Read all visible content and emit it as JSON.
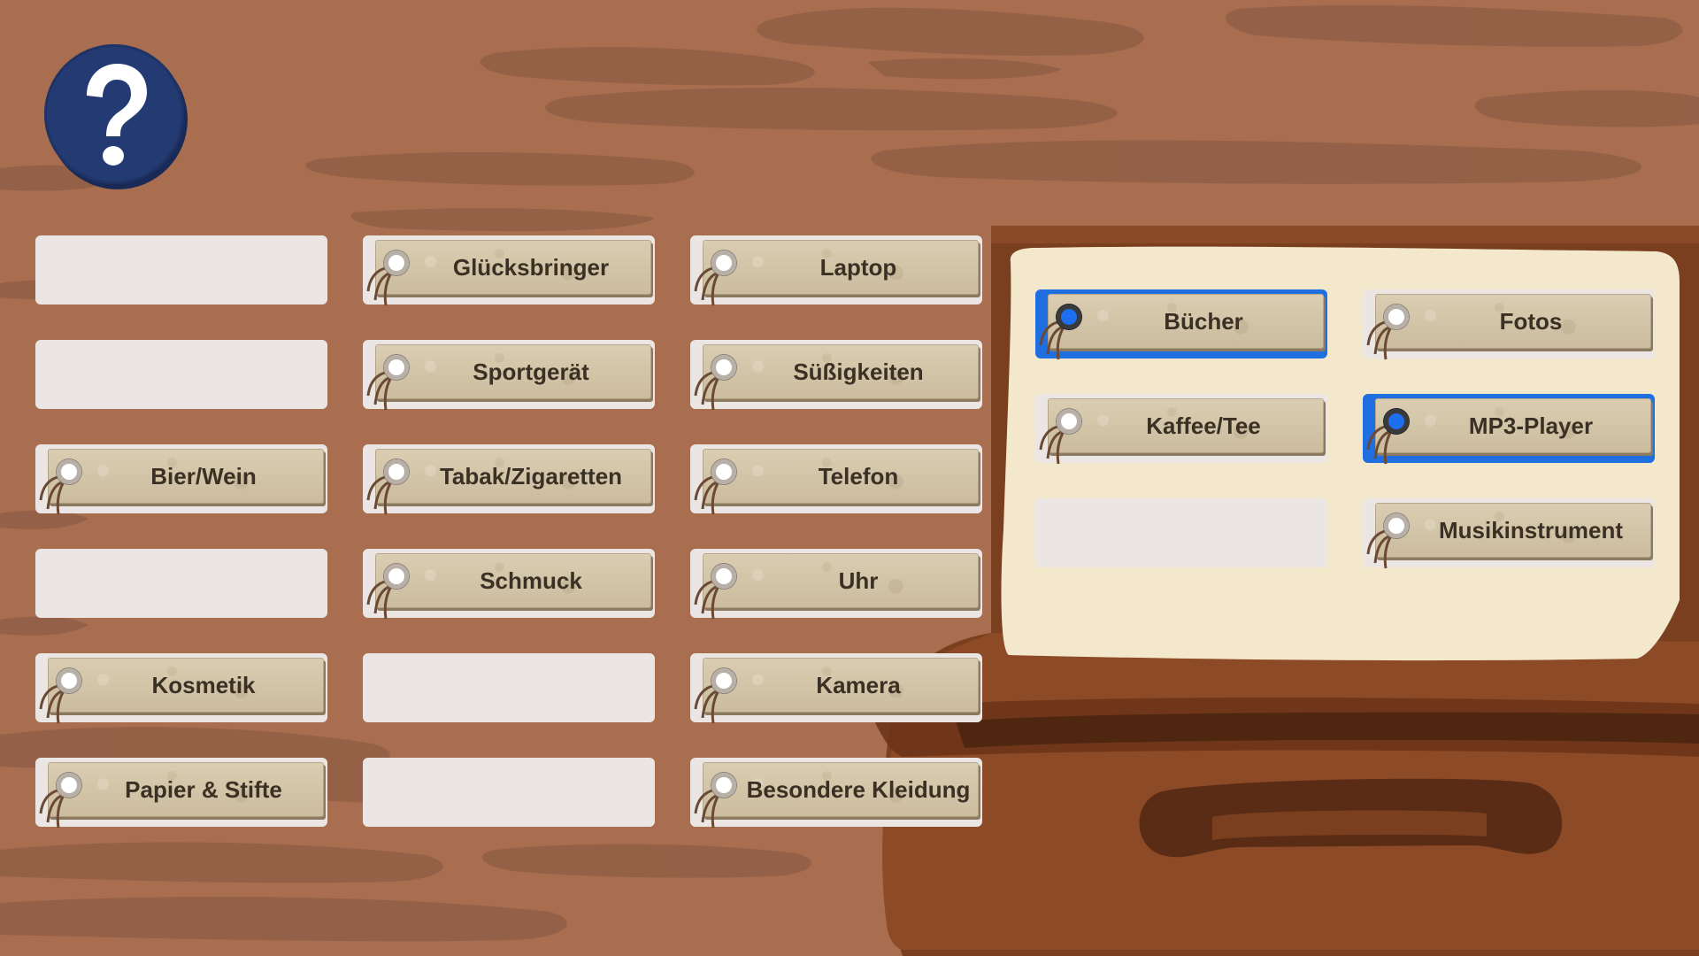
{
  "help_button": {
    "icon": "question-mark-icon"
  },
  "colors": {
    "background": "#a86e4f",
    "tag": "#d3c5a8",
    "empty_slot": "#ebe6e3",
    "selected": "#1f6fe0",
    "help": "#233a73"
  },
  "left_grid": {
    "columns": [
      [
        null,
        null,
        {
          "label": "Bier/Wein"
        },
        null,
        {
          "label": "Kosmetik"
        },
        {
          "label": "Papier & Stifte"
        }
      ],
      [
        {
          "label": "Glücksbringer"
        },
        {
          "label": "Sportgerät"
        },
        {
          "label": "Tabak/Zigaretten"
        },
        {
          "label": "Schmuck"
        },
        null,
        null
      ],
      [
        {
          "label": "Laptop"
        },
        {
          "label": "Süßigkeiten"
        },
        {
          "label": "Telefon"
        },
        {
          "label": "Uhr"
        },
        {
          "label": "Kamera"
        },
        {
          "label": "Besondere Kleidung"
        }
      ]
    ]
  },
  "suitcase": {
    "columns": [
      [
        {
          "label": "Bücher",
          "selected": true
        },
        {
          "label": "Kaffee/Tee",
          "selected": false
        },
        null
      ],
      [
        {
          "label": "Fotos",
          "selected": false
        },
        {
          "label": "MP3-Player",
          "selected": true
        },
        {
          "label": "Musikinstrument",
          "selected": false
        }
      ]
    ]
  }
}
